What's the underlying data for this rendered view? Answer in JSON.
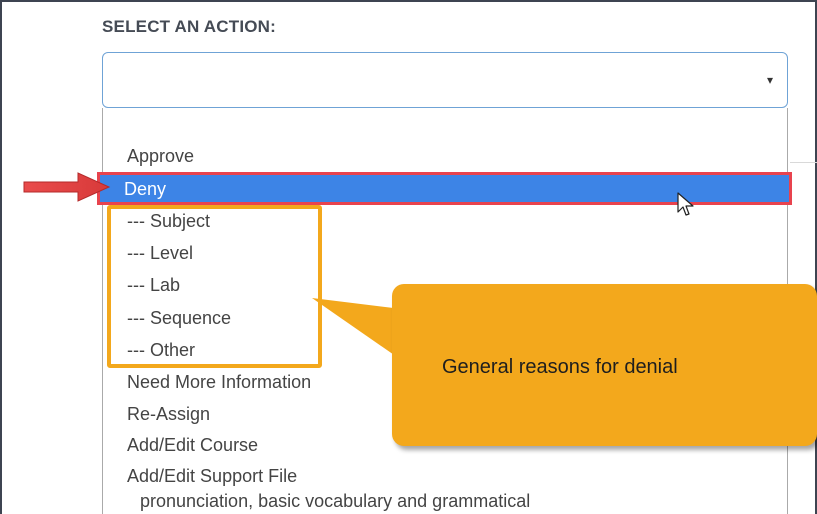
{
  "form": {
    "label": "SELECT AN ACTION:",
    "select_value": "",
    "arrow_glyph": "▾"
  },
  "options": [
    "Approve",
    "Deny",
    "--- Subject",
    "--- Level",
    "--- Lab",
    "--- Sequence",
    "--- Other",
    "Need More Information",
    "Re-Assign",
    "Add/Edit Course",
    "Add/Edit Support File"
  ],
  "selected_option": "Deny",
  "background_text": "pronunciation, basic vocabulary and grammatical",
  "annotation": {
    "callout_text": "General reasons for denial",
    "arrow_color": "#e8434e",
    "highlight_color": "#f3a81c"
  },
  "colors": {
    "selected_bg": "#3d84e6",
    "select_border": "#6fa3d6"
  }
}
